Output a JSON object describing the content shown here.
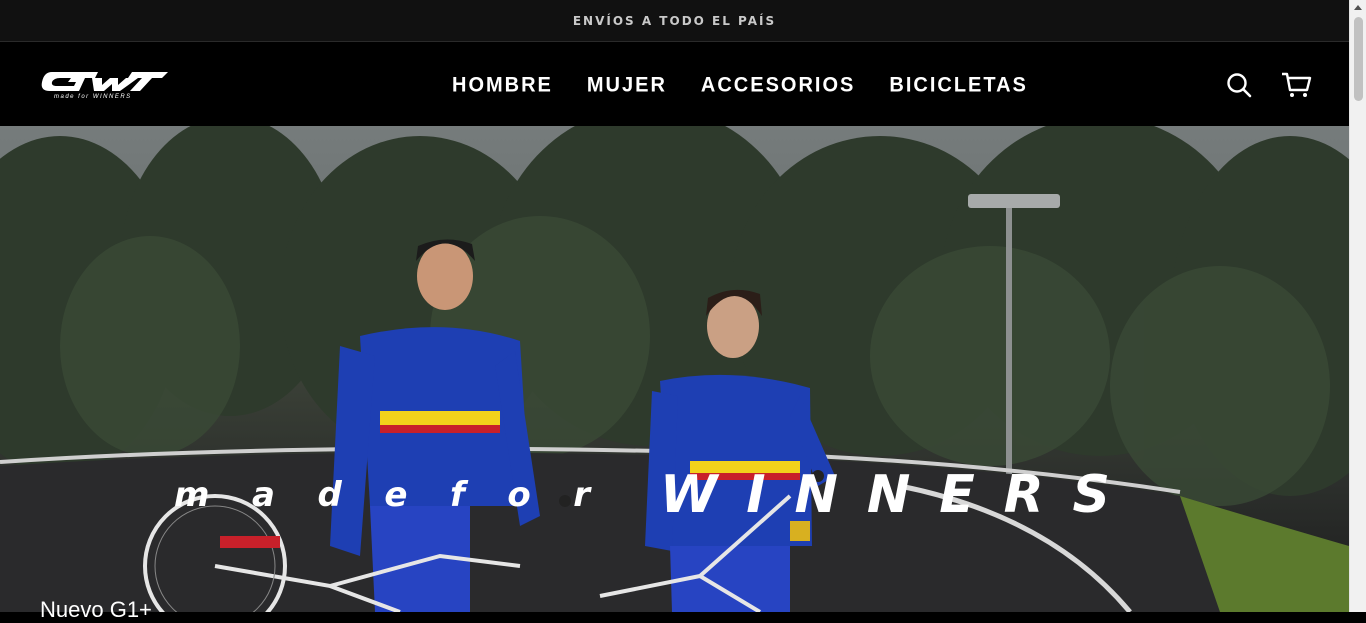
{
  "announcement": {
    "text": "ENVÍOS A TODO EL PAÍS"
  },
  "header": {
    "logo": {
      "brand": "GW",
      "tagline": "made for WINNERS"
    },
    "nav": [
      {
        "label": "HOMBRE"
      },
      {
        "label": "MUJER"
      },
      {
        "label": "ACCESORIOS"
      },
      {
        "label": "BICICLETAS"
      }
    ],
    "icons": {
      "search": "search-icon",
      "cart": "cart-icon"
    }
  },
  "hero": {
    "tagline_part1": "m a d e   f o r",
    "tagline_part2": "WINNERS",
    "caption": "Nuevo G1+"
  },
  "colors": {
    "header_bg": "#000000",
    "announcement_bg": "#111111",
    "jersey_blue": "#1f3fb0",
    "jersey_yellow": "#f2d21b",
    "jersey_red": "#c8202a"
  }
}
